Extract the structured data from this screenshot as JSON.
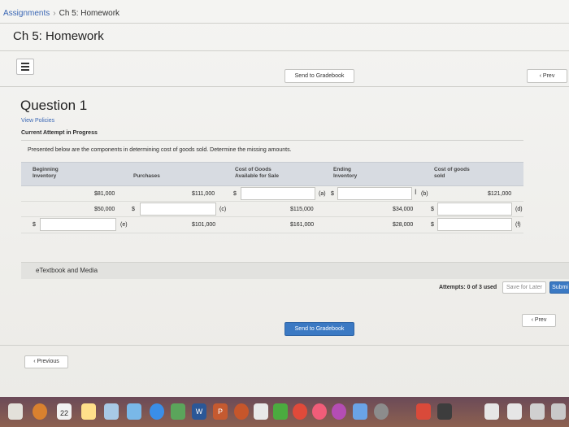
{
  "breadcrumb": {
    "link": "Assignments",
    "separator": "›",
    "current": "Ch 5: Homework"
  },
  "page_title": "Ch 5: Homework",
  "toolbar": {
    "send_to_gradebook": "Send to Gradebook",
    "prev": "‹ Prev"
  },
  "question": {
    "title": "Question 1",
    "view_policies": "View Policies",
    "attempt_status": "Current Attempt in Progress",
    "prompt": "Presented below are the components in determining cost of goods sold. Determine the missing amounts."
  },
  "table": {
    "headers": {
      "beginning_inventory": "Beginning Inventory",
      "purchases": "Purchases",
      "cost_available": "Cost of Goods Available for Sale",
      "ending_inventory": "Ending Inventory",
      "cost_sold": "Cost of goods sold"
    },
    "currency": "$",
    "rows": [
      {
        "beginning": "$81,000",
        "purchases": "$111,000",
        "available_label": "(a)",
        "ending_label": "(b)",
        "cogs": "$121,000"
      },
      {
        "beginning": "$50,000",
        "purchases_label": "(c)",
        "available": "$115,000",
        "ending": "$34,000",
        "cogs_label": "(d)"
      },
      {
        "beginning_label": "(e)",
        "purchases": "$101,000",
        "available": "$161,000",
        "ending": "$28,000",
        "cogs_label": "(f)"
      }
    ]
  },
  "etextbook": "eTextbook and Media",
  "attempts": {
    "text": "Attempts: 0 of 3 used",
    "save_later": "Save for Later",
    "submit": "Submi"
  },
  "nav": {
    "prev_bottom": "‹ Prev",
    "send_bottom": "Send to Gradebook",
    "previous": "‹ Previous"
  },
  "dock": {
    "calendar_day": "22"
  },
  "colors": {
    "link": "#3a67b5",
    "primary_button": "#3b79c3",
    "table_header": "#d7dbe1"
  }
}
